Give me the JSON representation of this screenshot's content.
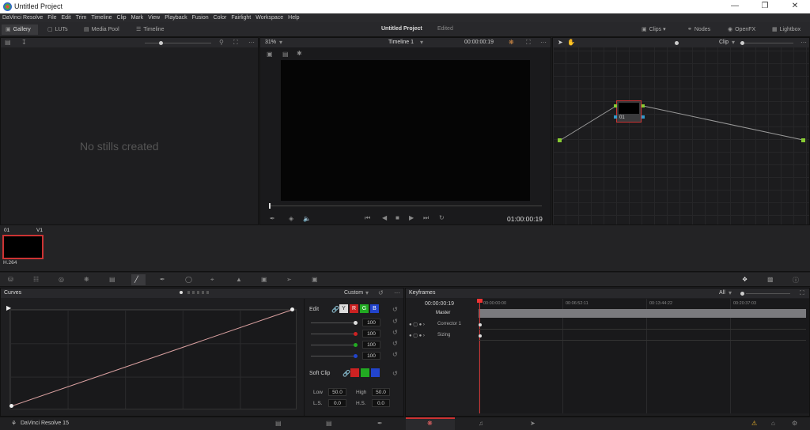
{
  "window": {
    "title": "Untitled Project"
  },
  "menu": [
    "DaVinci Resolve",
    "File",
    "Edit",
    "Trim",
    "Timeline",
    "Clip",
    "Mark",
    "View",
    "Playback",
    "Fusion",
    "Color",
    "Fairlight",
    "Workspace",
    "Help"
  ],
  "toolbar": {
    "gallery": "Gallery",
    "luts": "LUTs",
    "media_pool": "Media Pool",
    "timeline": "Timeline",
    "project_title": "Untitled Project",
    "project_status": "Edited",
    "clips": "Clips",
    "nodes": "Nodes",
    "openfx": "OpenFX",
    "lightbox": "Lightbox"
  },
  "gallery": {
    "empty": "No stills created"
  },
  "viewer": {
    "zoom": "31%",
    "timeline": "Timeline 1",
    "timecode_top": "00:00:00:19",
    "timecode": "01:00:00:19"
  },
  "nodes": {
    "mode": "Clip",
    "node_label": "01"
  },
  "clip": {
    "index": "01",
    "track": "V1",
    "codec": "H.264"
  },
  "curves": {
    "title": "Curves",
    "preset": "Custom",
    "edit_label": "Edit",
    "y": "Y",
    "r": "R",
    "g": "G",
    "b": "B",
    "values": [
      "100",
      "100",
      "100",
      "100"
    ],
    "soft_clip": "Soft Clip",
    "low_label": "Low",
    "low": "50.0",
    "high_label": "High",
    "high": "50.0",
    "ls_label": "L.S.",
    "ls": "0.0",
    "hs_label": "H.S.",
    "hs": "0.0"
  },
  "keyframes": {
    "title": "Keyframes",
    "filter": "All",
    "timecode": "00:00:00:19",
    "ticks": [
      "00:00:00:00",
      "00:06:52:11",
      "00:13:44:22",
      "00:20:37:03"
    ],
    "rows": [
      "Master",
      "Corrector 1",
      "Sizing"
    ]
  },
  "bottom": {
    "app": "DaVinci Resolve 15"
  }
}
